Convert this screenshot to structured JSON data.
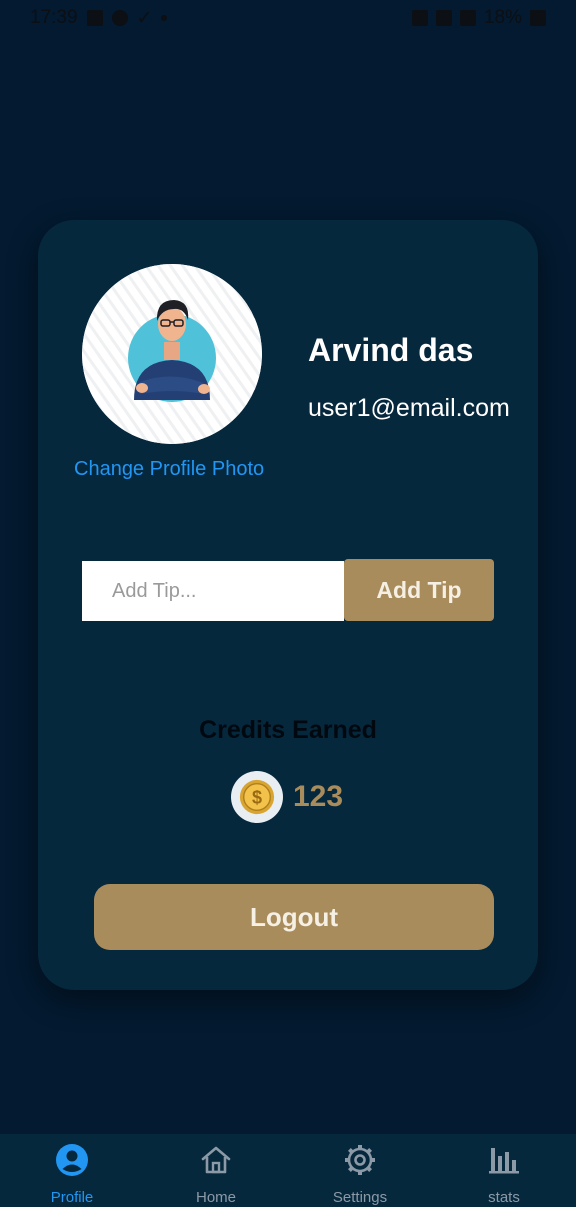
{
  "status_bar": {
    "time": "17:39",
    "battery": "18%"
  },
  "profile": {
    "name": "Arvind das",
    "email": "user1@email.com",
    "change_photo_label": "Change Profile Photo",
    "avatar_icon": "person-illustration"
  },
  "tip": {
    "placeholder": "Add Tip...",
    "value": "",
    "button_label": "Add Tip"
  },
  "credits": {
    "title": "Credits Earned",
    "value": "123",
    "icon": "coin-icon"
  },
  "logout_label": "Logout",
  "nav": {
    "items": [
      {
        "label": "Profile",
        "icon": "profile-icon",
        "active": true
      },
      {
        "label": "Home",
        "icon": "home-icon",
        "active": false
      },
      {
        "label": "Settings",
        "icon": "gear-icon",
        "active": false
      },
      {
        "label": "stats",
        "icon": "bar-chart-icon",
        "active": false
      }
    ]
  },
  "colors": {
    "background": "#031a30",
    "card": "#06283d",
    "accent_gold": "#a88c5c",
    "link_blue": "#2196f3"
  }
}
